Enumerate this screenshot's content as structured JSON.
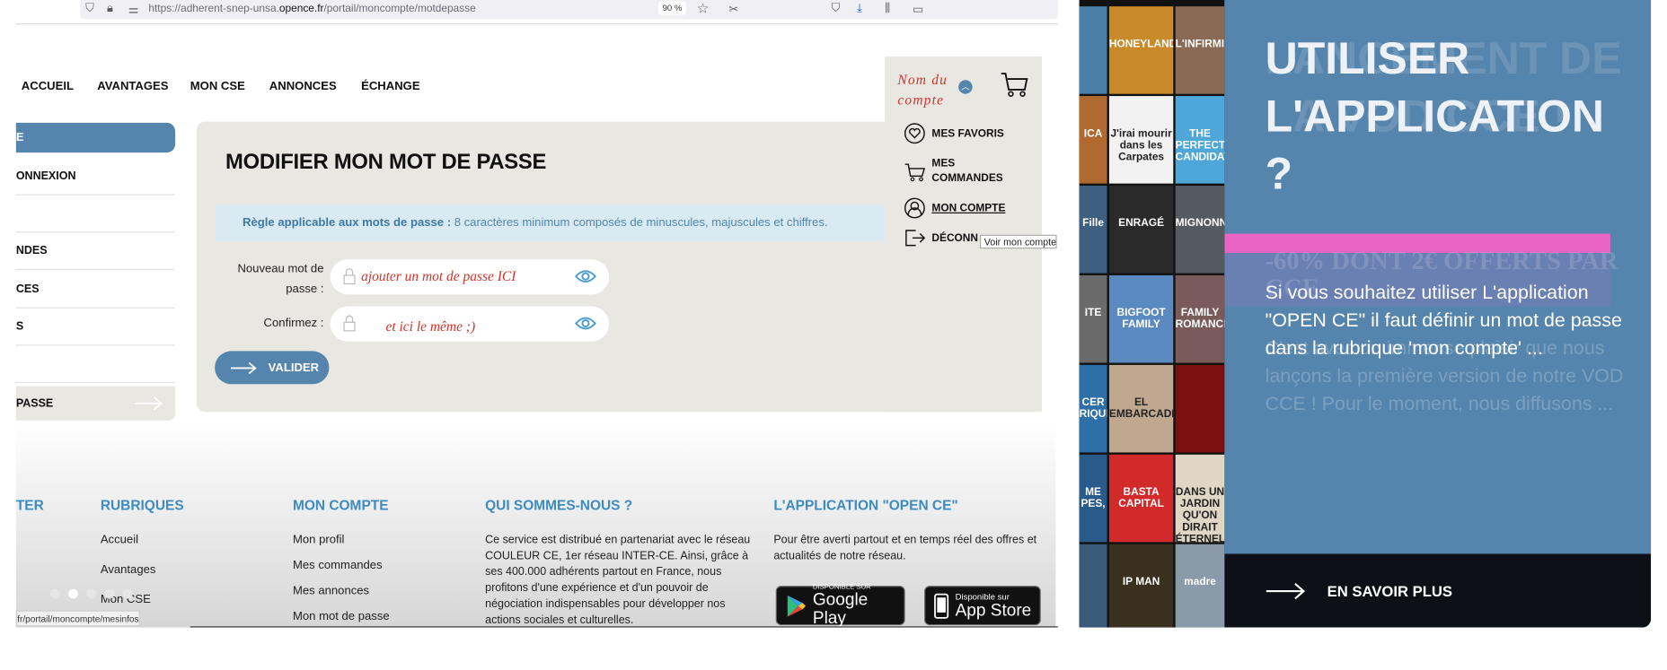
{
  "browser": {
    "url_prefix": "https://adherent-snep-unsa.",
    "url_domain": "opence.fr",
    "url_path": "/portail/moncompte/motdepasse",
    "zoom": "90 %",
    "status_url": "ence.fr/portail/moncompte/mesinfos"
  },
  "nav": {
    "items": [
      "ACCUEIL",
      "AVANTAGES",
      "MON CSE",
      "ANNONCES",
      "ÉCHANGE"
    ]
  },
  "account": {
    "name": "Nom du compte",
    "menu": [
      "MES FAVORIS",
      "MES COMMANDES",
      "MON COMPTE",
      "DÉCONN"
    ],
    "tooltip": "Voir mon compte"
  },
  "sidebar": {
    "button": "E",
    "items": [
      "ONNEXION",
      "",
      "NDES",
      "CES",
      "S",
      ""
    ],
    "active": "PASSE"
  },
  "form": {
    "title": "MODIFIER MON MOT DE PASSE",
    "rule_label": "Règle applicable aux mots de passe :",
    "rule_text": " 8 caractères minimum composés de minuscules, majuscules et chiffres.",
    "new_label": "Nouveau mot de passe :",
    "new_value": "ajouter un mot de passe ICI",
    "confirm_label": "Confirmez :",
    "confirm_value": "et ici le même ;)",
    "submit": "VALIDER"
  },
  "footer": {
    "col0_heading": "TER",
    "rubriques": {
      "heading": "RUBRIQUES",
      "links": [
        "Accueil",
        "Avantages",
        "Mon CSE"
      ]
    },
    "compte": {
      "heading": "MON COMPTE",
      "links": [
        "Mon profil",
        "Mes commandes",
        "Mes annonces",
        "Mon mot de passe"
      ]
    },
    "about": {
      "heading": "QUI SOMMES-NOUS ?",
      "text": "Ce service est distribué en partenariat avec le réseau COULEUR CE, 1er réseau INTER-CE. Ainsi, grâce à ses 400.000 adhérents partout en France, nous profitons d'une expérience et d'un pouvoir de négociation indispensables pour développer nos actions sociales et culturelles."
    },
    "app": {
      "heading": "L'APPLICATION \"OPEN CE\"",
      "text": "Pour être averti partout et en temps réel des offres et actualités de notre réseau.",
      "google_small": "DISPONIBLE SUR",
      "google_big": "Google Play",
      "apple_small": "Disponible sur",
      "apple_big": "App Store"
    }
  },
  "carousel": {
    "count": 5,
    "active": 2
  },
  "posters": [
    {
      "title": "",
      "color": "#4a7fa8"
    },
    {
      "title": "HONEYLAND",
      "color": "#c98a2a"
    },
    {
      "title": "L'INFIRMIÈRE",
      "color": "#8a6a55"
    },
    {
      "title": "ICA",
      "color": "#b06a30"
    },
    {
      "title": "J'irai mourir dans les Carpates",
      "color": "#f2f2f2"
    },
    {
      "title": "THE PERFECT CANDIDATE",
      "color": "#4fa6d8"
    },
    {
      "title": "Fille",
      "color": "#3e5f80"
    },
    {
      "title": "ENRAGÉ",
      "color": "#2a2a2a"
    },
    {
      "title": "MIGNONNES",
      "color": "#555a60"
    },
    {
      "title": "ITE",
      "color": "#6a6a6a"
    },
    {
      "title": "BIGFOOT FAMILY",
      "color": "#5a8ac0"
    },
    {
      "title": "FAMILY ROMANCE",
      "color": "#7a5a5a"
    },
    {
      "title": "CER RIQUE",
      "color": "#2f6fa8"
    },
    {
      "title": "EL EMBARCADERO",
      "color": "#c0a890"
    },
    {
      "title": "",
      "color": "#7a1010"
    },
    {
      "title": "ME PES,",
      "color": "#2a5a8a"
    },
    {
      "title": "BASTA CAPITAL",
      "color": "#d22a2a"
    },
    {
      "title": "DANS UN JARDIN QU'ON DIRAIT ÉTERNEL",
      "color": "#e0d6c6"
    },
    {
      "title": "",
      "color": "#3a5a7a"
    },
    {
      "title": "IP MAN",
      "color": "#3a3020"
    },
    {
      "title": "madre",
      "color": "#8a9aa8"
    }
  ],
  "promo": {
    "ghost_title": "LANCEMENT DE LA VOD CCE !",
    "title": "UTILISER L'APPLICATION ?",
    "ghost_offer": "-60% DONT 2€ OFFERTS PAR CCE",
    "ghost_body": "C'est avec un immense plaisir que nous lançons la première version de notre VOD CCE ! Pour le moment, nous diffusons ...",
    "body": "Si vous souhaitez utiliser L'application \"OPEN CE\" il faut définir un mot de passe dans la rubrique 'mon compte' ...",
    "cta": "EN SAVOIR PLUS",
    "colors": {
      "panel": "#5585ad",
      "pink": "#e864c4",
      "cta_bg": "#0d1117"
    }
  }
}
